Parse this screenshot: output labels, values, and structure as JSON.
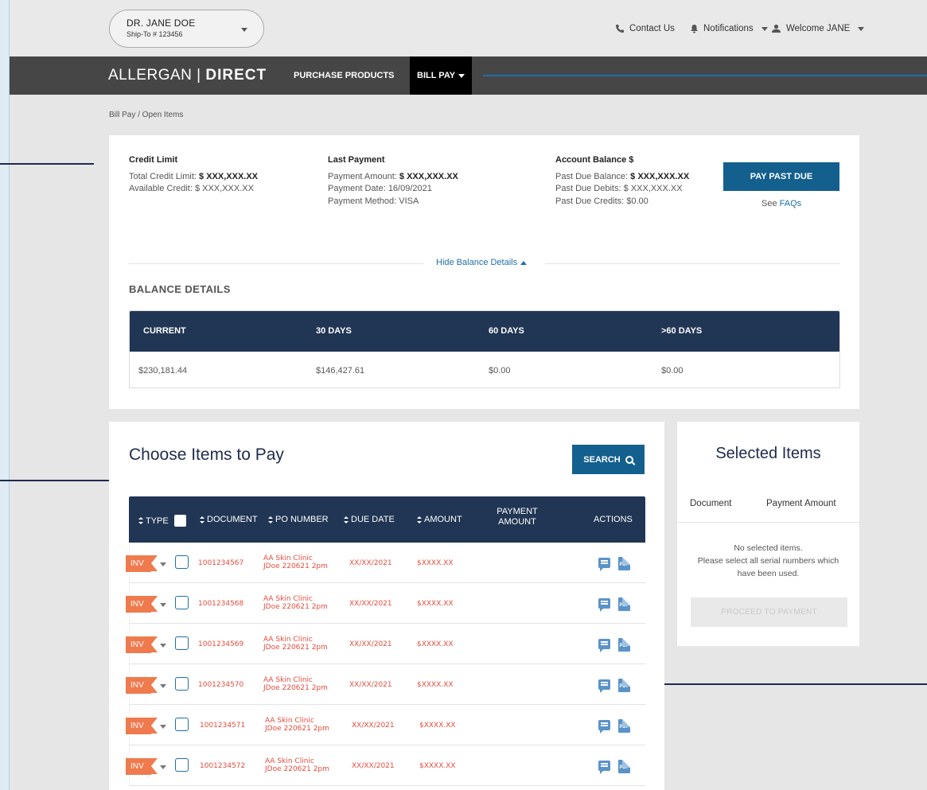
{
  "account": {
    "name": "DR. JANE DOE",
    "ship_to": "Ship-To # 123456"
  },
  "top_links": {
    "contact": "Contact Us",
    "notifications": "Notifications",
    "welcome": "Welcome JANE"
  },
  "nav": {
    "logo_left": "ALLERGAN",
    "logo_sep": "|",
    "logo_right": "DIRECT",
    "purchase": "PURCHASE PRODUCTS",
    "bill_pay": "BILL PAY"
  },
  "breadcrumb": "Bill Pay  /  Open Items",
  "summary": {
    "credit": {
      "title": "Credit Limit",
      "total_label": "Total Credit Limit: ",
      "total_value": "$ XXX,XXX.XX",
      "available": "Available Credit: $ XXX,XXX.XX"
    },
    "last_payment": {
      "title": "Last Payment",
      "amount_label": "Payment Amount: ",
      "amount_value": "$ XXX,XXX.XX",
      "date": "Payment Date: 16/09/2021",
      "method": "Payment Method: VISA"
    },
    "balance": {
      "title": "Account Balance $",
      "past_due_label": "Past Due Balance: ",
      "past_due_value": "$ XXX,XXX.XX",
      "debits": "Past Due Debits: $ XXX,XXX.XX",
      "credits": "Past Due Credits: $0.00"
    },
    "pay_button": "PAY PAST DUE",
    "faq_prefix": "See ",
    "faq_link": "FAQs",
    "hide_details": "Hide Balance Details"
  },
  "balance_details": {
    "title": "BALANCE DETAILS",
    "headers": [
      "CURRENT",
      "30 DAYS",
      "60 DAYS",
      ">60 DAYS"
    ],
    "values": [
      "$230,181.44",
      "$146,427.61",
      "$0.00",
      "$0.00"
    ]
  },
  "items": {
    "title": "Choose Items to Pay",
    "search": "SEARCH",
    "headers": {
      "type": "TYPE",
      "document": "DOCUMENT",
      "po": "PO NUMBER",
      "due": "DUE DATE",
      "amount": "AMOUNT",
      "payment_1": "PAYMENT",
      "payment_2": "AMOUNT",
      "actions": "ACTIONS"
    },
    "rows": [
      {
        "type": "INV",
        "document": "1001234567",
        "po_1": "AA Skin Clinic",
        "po_2": "JDoe 220621 2pm",
        "due": "XX/XX/2021",
        "amount": "$XXXX.XX",
        "pdf": "PDF"
      },
      {
        "type": "INV",
        "document": "1001234568",
        "po_1": "AA Skin Clinic",
        "po_2": "JDoe 220621 2pm",
        "due": "XX/XX/2021",
        "amount": "$XXXX.XX",
        "pdf": "PDF"
      },
      {
        "type": "INV",
        "document": "1001234569",
        "po_1": "AA Skin Clinic",
        "po_2": "JDoe 220621 2pm",
        "due": "XX/XX/2021",
        "amount": "$XXXX.XX",
        "pdf": "PDF"
      },
      {
        "type": "INV",
        "document": "1001234570",
        "po_1": "AA Skin Clinic",
        "po_2": "JDoe 220621 2pm",
        "due": "XX/XX/2021",
        "amount": "$XXXX.XX",
        "pdf": "PDF"
      },
      {
        "type": "INV",
        "document": "1001234571",
        "po_1": "AA Skin Clinic",
        "po_2": "JDoe 220621 2pm",
        "due": "XX/XX/2021",
        "amount": "$XXXX.XX",
        "pdf": "PDF"
      },
      {
        "type": "INV",
        "document": "1001234572",
        "po_1": "AA Skin Clinic",
        "po_2": "JDoe 220621 2pm",
        "due": "XX/XX/2021",
        "amount": "$XXXX.XX",
        "pdf": "PDF"
      }
    ]
  },
  "selected": {
    "title": "Selected Items",
    "col_document": "Document",
    "col_amount": "Payment Amount",
    "empty_1": "No selected items.",
    "empty_2": "Please select all serial numbers which",
    "empty_3": "have been used.",
    "proceed": "PROCEED TO PAYMENT"
  },
  "colors": {
    "navy": "#213654",
    "primary": "#135f8e",
    "accent": "#ef7a4d",
    "error_text": "#e84b3c",
    "nav_bg": "#464646"
  },
  "icons": {
    "contact": "phone-icon",
    "notifications": "bell-icon",
    "welcome": "user-icon",
    "search": "search-icon",
    "actions": [
      "comment-icon",
      "pdf-icon"
    ]
  }
}
